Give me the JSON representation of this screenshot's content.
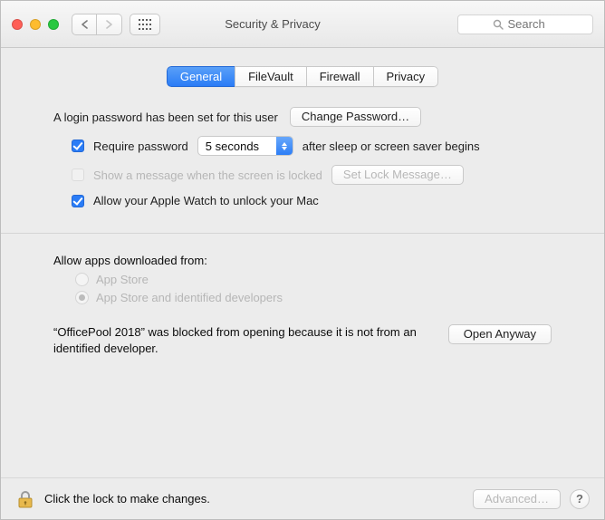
{
  "window": {
    "title": "Security & Privacy",
    "search_placeholder": "Search"
  },
  "tabs": {
    "general": "General",
    "filevault": "FileVault",
    "firewall": "Firewall",
    "privacy": "Privacy"
  },
  "general": {
    "password_set_label": "A login password has been set for this user",
    "change_password_button": "Change Password…",
    "require_password_label": "Require password",
    "require_password_delay": "5 seconds",
    "after_sleep_label": "after sleep or screen saver begins",
    "show_message_label": "Show a message when the screen is locked",
    "set_lock_message_button": "Set Lock Message…",
    "apple_watch_label": "Allow your Apple Watch to unlock your Mac"
  },
  "gatekeeper": {
    "heading": "Allow apps downloaded from:",
    "option_app_store": "App Store",
    "option_identified": "App Store and identified developers",
    "blocked_message": "“OfficePool 2018” was blocked from opening because it is not from an identified developer.",
    "open_anyway_button": "Open Anyway"
  },
  "footer": {
    "lock_hint": "Click the lock to make changes.",
    "advanced_button": "Advanced…",
    "help_symbol": "?"
  }
}
